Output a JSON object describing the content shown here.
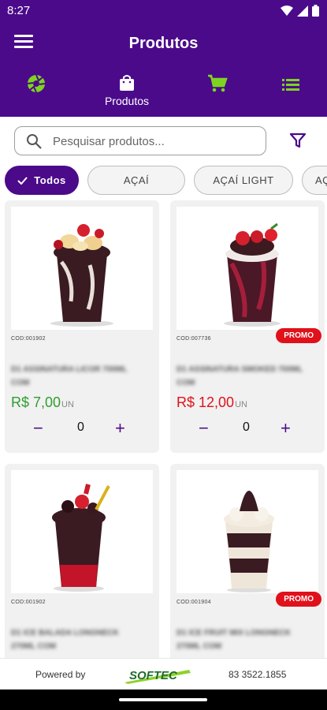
{
  "status_bar": {
    "time": "8:27"
  },
  "app_bar": {
    "title": "Produtos",
    "menu_icon": "hamburger-icon"
  },
  "tabs": [
    {
      "icon": "aperture-icon",
      "label": ""
    },
    {
      "icon": "shopping-bag-icon",
      "label": "Produtos"
    },
    {
      "icon": "cart-icon",
      "label": ""
    },
    {
      "icon": "list-icon",
      "label": ""
    }
  ],
  "search": {
    "placeholder": "Pesquisar produtos...",
    "value": ""
  },
  "filter": {
    "icon": "filter-icon"
  },
  "categories": [
    {
      "label": "Todos",
      "selected": true
    },
    {
      "label": "AÇAÍ",
      "selected": false
    },
    {
      "label": "AÇAÍ LIGHT",
      "selected": false
    },
    {
      "label": "AÇ",
      "selected": false
    }
  ],
  "products": [
    {
      "code": "COD:001902",
      "name": "D1 ASSINATURA LICOR 700ML COM",
      "price": "R$ 7,00",
      "unit": "UN",
      "quantity": "0",
      "promo": "",
      "price_color": "#2e9e2e"
    },
    {
      "code": "COD:007736",
      "name": "D1 ASSINATURA SMOKED 700ML COM",
      "price": "R$ 12,00",
      "unit": "UN",
      "quantity": "0",
      "promo": "PROMO",
      "price_color": "#e0111b"
    },
    {
      "code": "COD:001902",
      "name": "D1 ICE BALADA LONGNECK 270ML COM",
      "price": "",
      "unit": "",
      "quantity": "",
      "promo": "",
      "price_color": "#2e9e2e"
    },
    {
      "code": "COD:001904",
      "name": "D1 ICE FRUIT MIX LONGNECK 270ML COM",
      "price": "",
      "unit": "",
      "quantity": "",
      "promo": "PROMO",
      "price_color": "#e0111b"
    }
  ],
  "footer": {
    "powered_by": "Powered by",
    "brand": "SOFTEC",
    "phone": "83 3522.1855"
  },
  "colors": {
    "primary": "#4b0a8a",
    "accent_green": "#7ed321",
    "promo_red": "#e0111b"
  }
}
